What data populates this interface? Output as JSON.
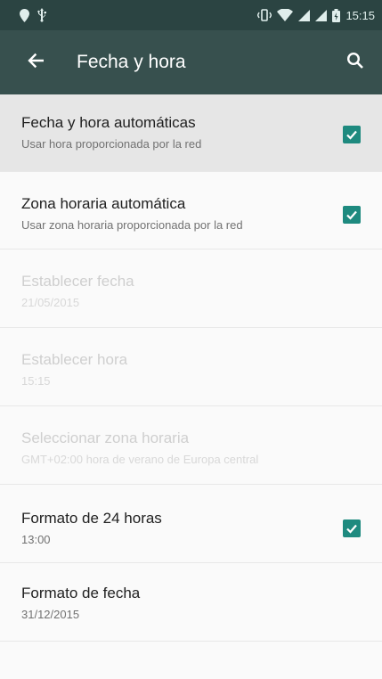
{
  "status_bar": {
    "time": "15:15",
    "left_icons": [
      "location-pin-icon",
      "usb-icon"
    ],
    "right_icons": [
      "vibrate-icon",
      "wifi-icon",
      "signal-icon",
      "signal-icon",
      "battery-icon"
    ]
  },
  "app_bar": {
    "title": "Fecha y hora",
    "back_icon": "arrow-left-icon",
    "search_icon": "search-icon"
  },
  "settings": [
    {
      "title": "Fecha y hora automáticas",
      "subtitle": "Usar hora proporcionada por la red",
      "checked": true,
      "enabled": true,
      "highlighted": true
    },
    {
      "title": "Zona horaria automática",
      "subtitle": "Usar zona horaria proporcionada por la red",
      "checked": true,
      "enabled": true
    },
    {
      "title": "Establecer fecha",
      "subtitle": "21/05/2015",
      "enabled": false
    },
    {
      "title": "Establecer hora",
      "subtitle": "15:15",
      "enabled": false
    },
    {
      "title": "Seleccionar zona horaria",
      "subtitle": "GMT+02:00 hora de verano de Europa central",
      "enabled": false
    },
    {
      "title": "Formato de 24 horas",
      "subtitle": "13:00",
      "checked": true,
      "enabled": true
    },
    {
      "title": "Formato de fecha",
      "subtitle": "31/12/2015",
      "enabled": true
    }
  ],
  "colors": {
    "status_bar": "#2b4442",
    "app_bar": "#37504e",
    "checkbox": "#1e8a7f",
    "highlight_row": "#e6e6e6"
  }
}
